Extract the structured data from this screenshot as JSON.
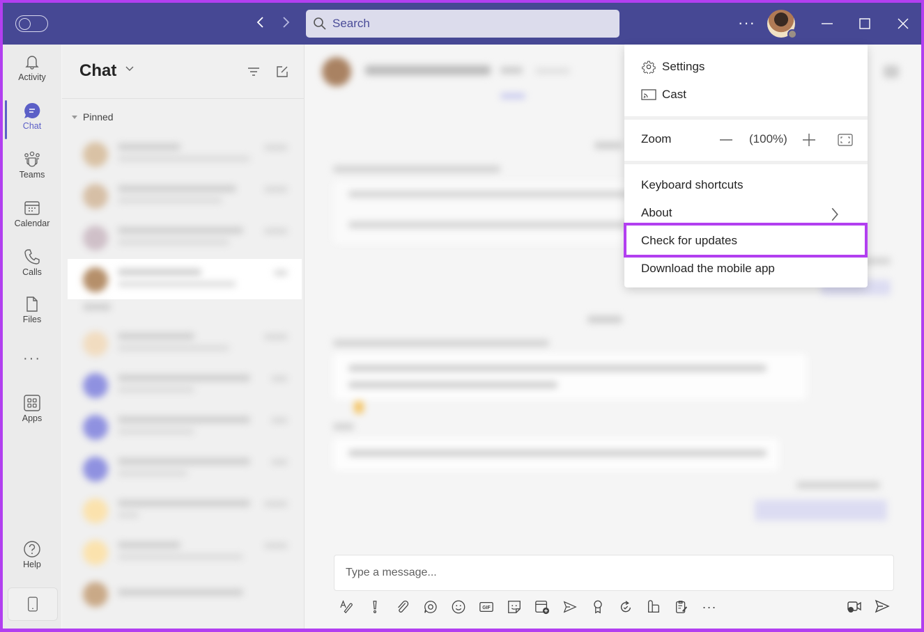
{
  "titlebar": {
    "search_placeholder": "Search",
    "more_label": "···",
    "user_status": "available"
  },
  "rail": {
    "items": [
      {
        "label": "Activity",
        "icon": "bell-icon"
      },
      {
        "label": "Chat",
        "icon": "chat-icon",
        "active": true
      },
      {
        "label": "Teams",
        "icon": "teams-icon"
      },
      {
        "label": "Calendar",
        "icon": "calendar-icon"
      },
      {
        "label": "Calls",
        "icon": "phone-icon"
      },
      {
        "label": "Files",
        "icon": "file-icon"
      },
      {
        "label": "···",
        "icon": "more-icon"
      },
      {
        "label": "Apps",
        "icon": "apps-icon"
      },
      {
        "label": "Help",
        "icon": "help-icon"
      }
    ],
    "accent": "#5b5fc7"
  },
  "chatlist": {
    "title": "Chat",
    "section": "Pinned"
  },
  "main": {
    "compose_placeholder": "Type a message..."
  },
  "menu": {
    "settings": "Settings",
    "cast": "Cast",
    "zoom_label": "Zoom",
    "zoom_value": "(100%)",
    "keyboard_shortcuts": "Keyboard shortcuts",
    "about": "About",
    "check_updates": "Check for updates",
    "download_app": "Download the mobile app",
    "highlight_color": "#b23ff0"
  },
  "colors": {
    "titlebar": "#464894",
    "accent": "#5b5fc7",
    "highlight": "#b23ff0"
  }
}
